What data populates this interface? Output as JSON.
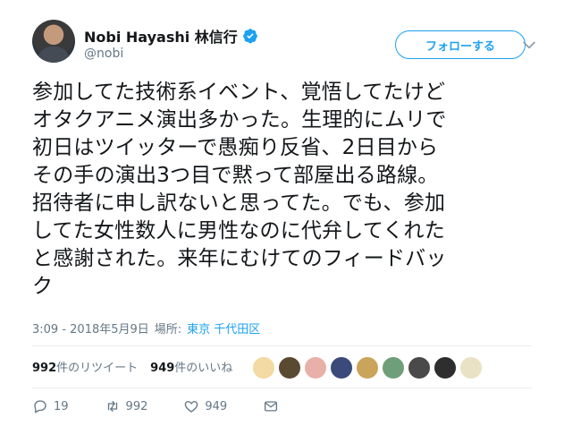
{
  "user": {
    "name": "Nobi Hayashi 林信行",
    "handle": "@nobi"
  },
  "follow_button": "フォローする",
  "tweet_text": "参加してた技術系イベント、覚悟してたけど\nオタクアニメ演出多かった。生理的にムリで\n初日はツイッターで愚痴り反省、2日目から\nその手の演出3つ目で黙って部屋出る路線。\n招待者に申し訳ないと思ってた。でも、参加\nしてた女性数人に男性なのに代弁してくれた\nと感謝された。来年にむけてのフィードバッ\nク",
  "meta": {
    "timestamp": "3:09 - 2018年5月9日",
    "place_label": "場所:",
    "place": "東京 千代田区"
  },
  "stats": {
    "retweets_count": "992",
    "retweets_label": "件のリツイート",
    "likes_count": "949",
    "likes_label": "件のいいね"
  },
  "likers": [
    {
      "icon": "avatar-1",
      "color": "#f3d9a2"
    },
    {
      "icon": "avatar-2",
      "color": "#5b4a32"
    },
    {
      "icon": "avatar-3",
      "color": "#e8b0a8"
    },
    {
      "icon": "avatar-4",
      "color": "#3b4a7a"
    },
    {
      "icon": "avatar-5",
      "color": "#c9a45a"
    },
    {
      "icon": "avatar-6",
      "color": "#6f9f7a"
    },
    {
      "icon": "avatar-7",
      "color": "#4a4a4a"
    },
    {
      "icon": "avatar-8",
      "color": "#2e2e2e"
    },
    {
      "icon": "avatar-9",
      "color": "#e9e2c4"
    }
  ],
  "actions": {
    "replies": "19",
    "retweets": "992",
    "likes": "949"
  },
  "colors": {
    "accent": "#1da1f2",
    "secondary_text": "#657786",
    "divider": "#e6ecf0"
  }
}
